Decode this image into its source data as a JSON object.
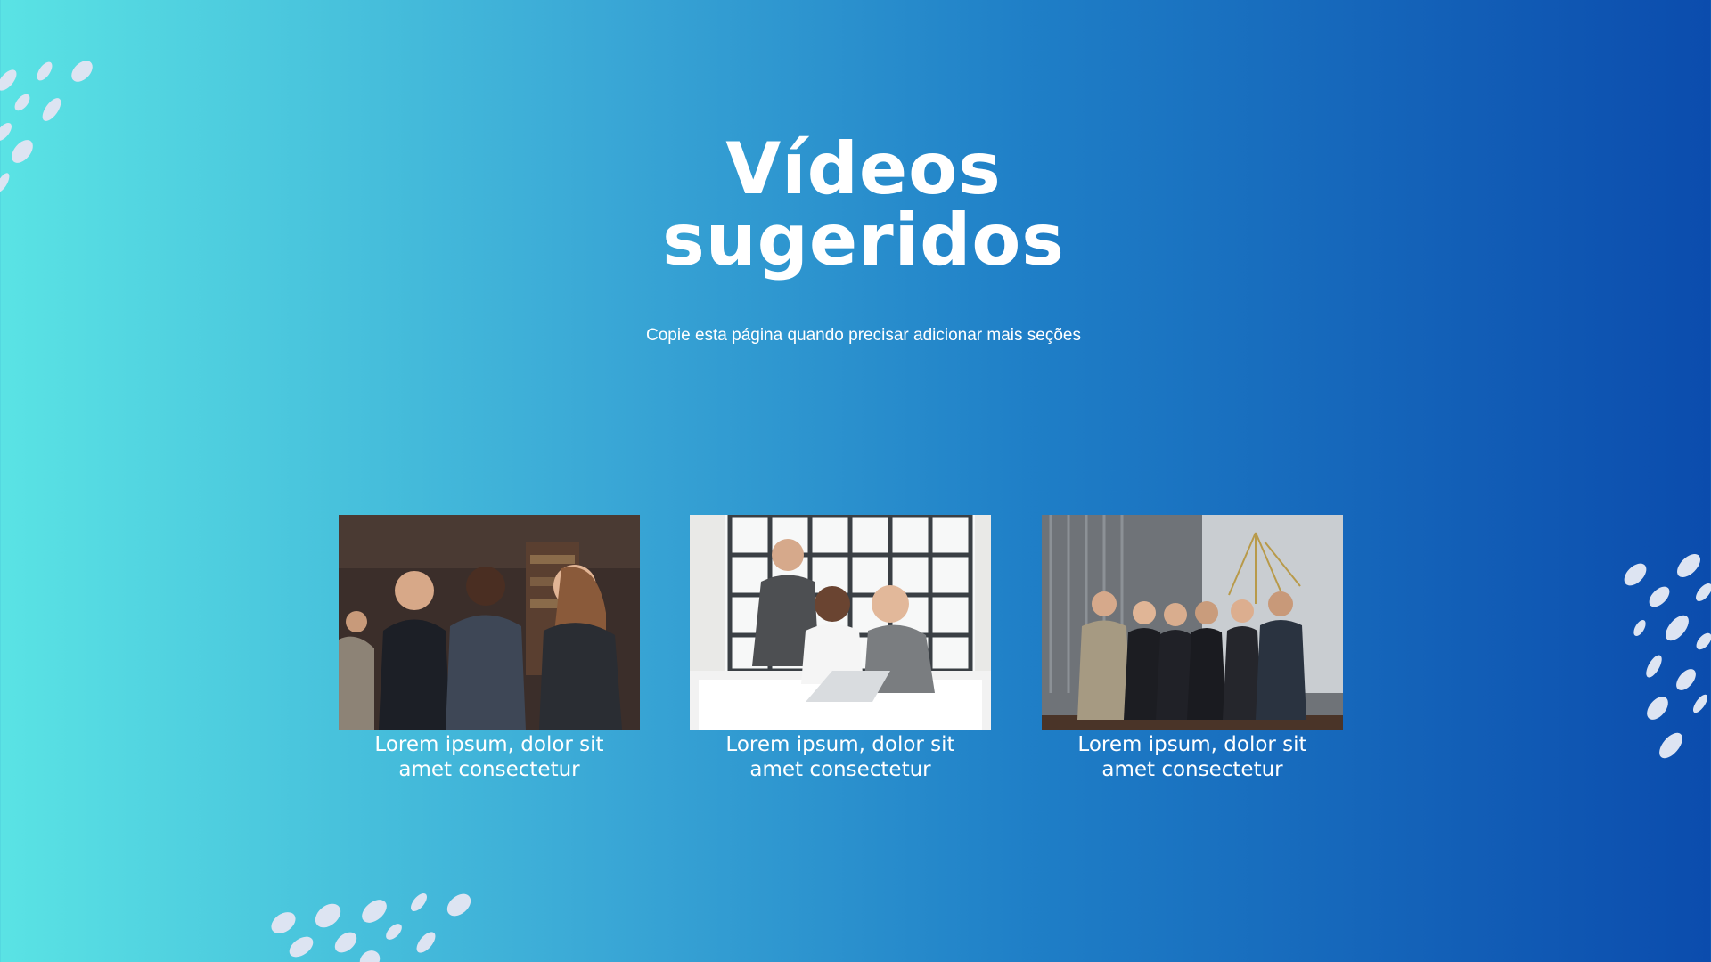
{
  "title": {
    "line1": "Vídeos",
    "line2": "sugeridos"
  },
  "subtitle": "Copie esta página quando precisar adicionar mais seções",
  "videos": [
    {
      "caption_line1": "Lorem ipsum, dolor sit",
      "caption_line2": "amet consectetur",
      "image": "business-people-talking-photo"
    },
    {
      "caption_line1": "Lorem ipsum, dolor sit",
      "caption_line2": "amet consectetur",
      "image": "team-at-laptop-photo"
    },
    {
      "caption_line1": "Lorem ipsum, dolor sit",
      "caption_line2": "amet consectetur",
      "image": "business-team-group-photo"
    }
  ],
  "colors": {
    "gradient_start": "#5ae3e4",
    "gradient_end": "#0b4cad",
    "text": "#ffffff",
    "brush_marks": "#dde4f2"
  },
  "decorations": [
    "brush-strokes-top-left",
    "brush-strokes-right",
    "brush-strokes-bottom"
  ]
}
